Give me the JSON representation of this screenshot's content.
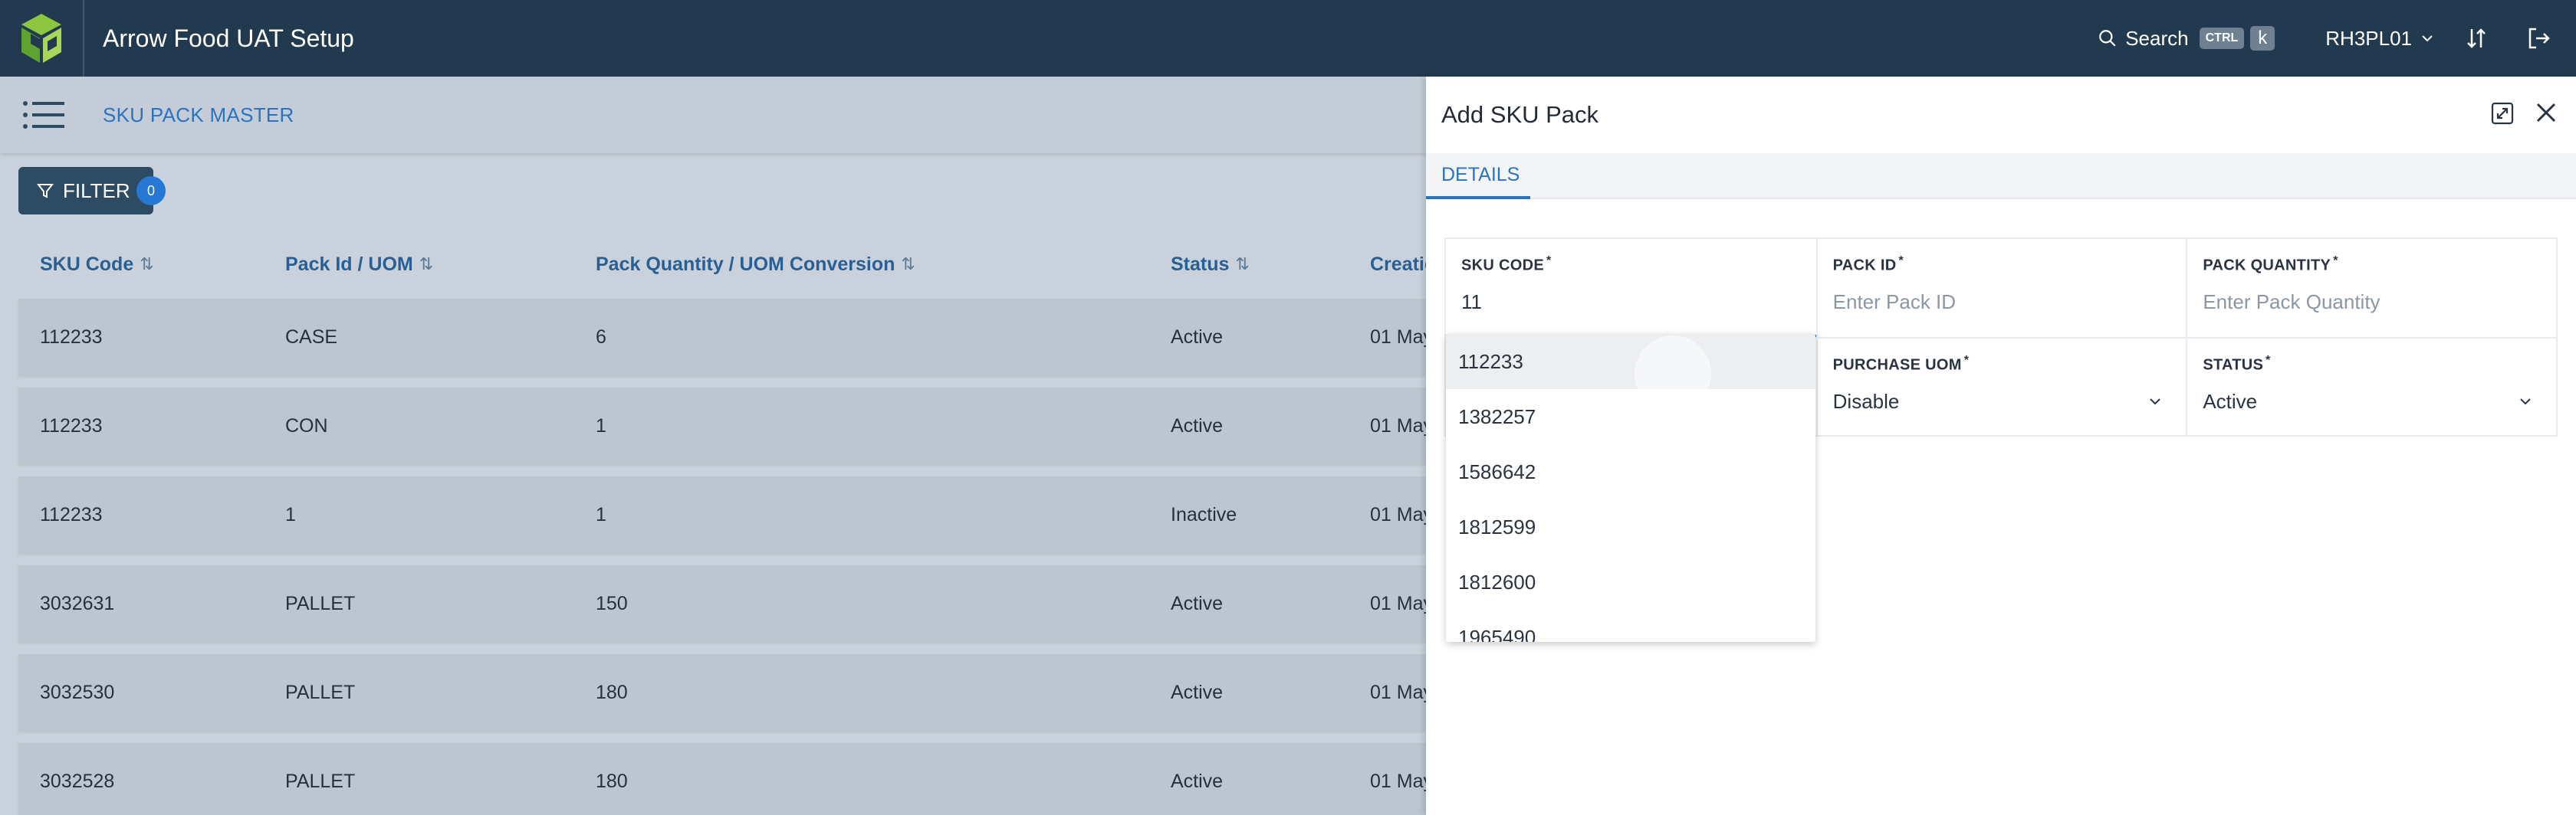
{
  "header": {
    "app_title": "Arrow Food UAT Setup",
    "search_label": "Search",
    "kbd_ctrl": "CTRL",
    "kbd_k": "k",
    "user": "RH3PL01"
  },
  "subheader": {
    "page_title": "SKU PACK MASTER"
  },
  "filter": {
    "label": "FILTER",
    "count": "0"
  },
  "table": {
    "columns": [
      "SKU Code",
      "Pack Id / UOM",
      "Pack Quantity / UOM Conversion",
      "Status",
      "Creatio"
    ],
    "rows": [
      {
        "sku": "112233",
        "pack": "CASE",
        "qty": "6",
        "status": "Active",
        "created": "01 May"
      },
      {
        "sku": "112233",
        "pack": "CON",
        "qty": "1",
        "status": "Active",
        "created": "01 May"
      },
      {
        "sku": "112233",
        "pack": "1",
        "qty": "1",
        "status": "Inactive",
        "created": "01 May"
      },
      {
        "sku": "3032631",
        "pack": "PALLET",
        "qty": "150",
        "status": "Active",
        "created": "01 May"
      },
      {
        "sku": "3032530",
        "pack": "PALLET",
        "qty": "180",
        "status": "Active",
        "created": "01 May"
      },
      {
        "sku": "3032528",
        "pack": "PALLET",
        "qty": "180",
        "status": "Active",
        "created": "01 May"
      }
    ]
  },
  "drawer": {
    "title": "Add SKU Pack",
    "tab": "DETAILS",
    "fields": {
      "sku_code": {
        "label": "SKU CODE",
        "value": "11"
      },
      "pack_id": {
        "label": "PACK ID",
        "placeholder": "Enter Pack ID"
      },
      "pack_quantity": {
        "label": "PACK QUANTITY",
        "placeholder": "Enter Pack Quantity"
      },
      "purchase_uom": {
        "label": "PURCHASE UOM",
        "value": "Disable"
      },
      "status": {
        "label": "STATUS",
        "value": "Active"
      }
    },
    "required_mark": "*",
    "sku_options": [
      "112233",
      "1382257",
      "1586642",
      "1812599",
      "1812600",
      "1965490"
    ]
  },
  "colors": {
    "header_bg": "#213a4f",
    "accent": "#2a73c0",
    "filter_bg": "#2d4b63",
    "badge": "#2778d4"
  }
}
